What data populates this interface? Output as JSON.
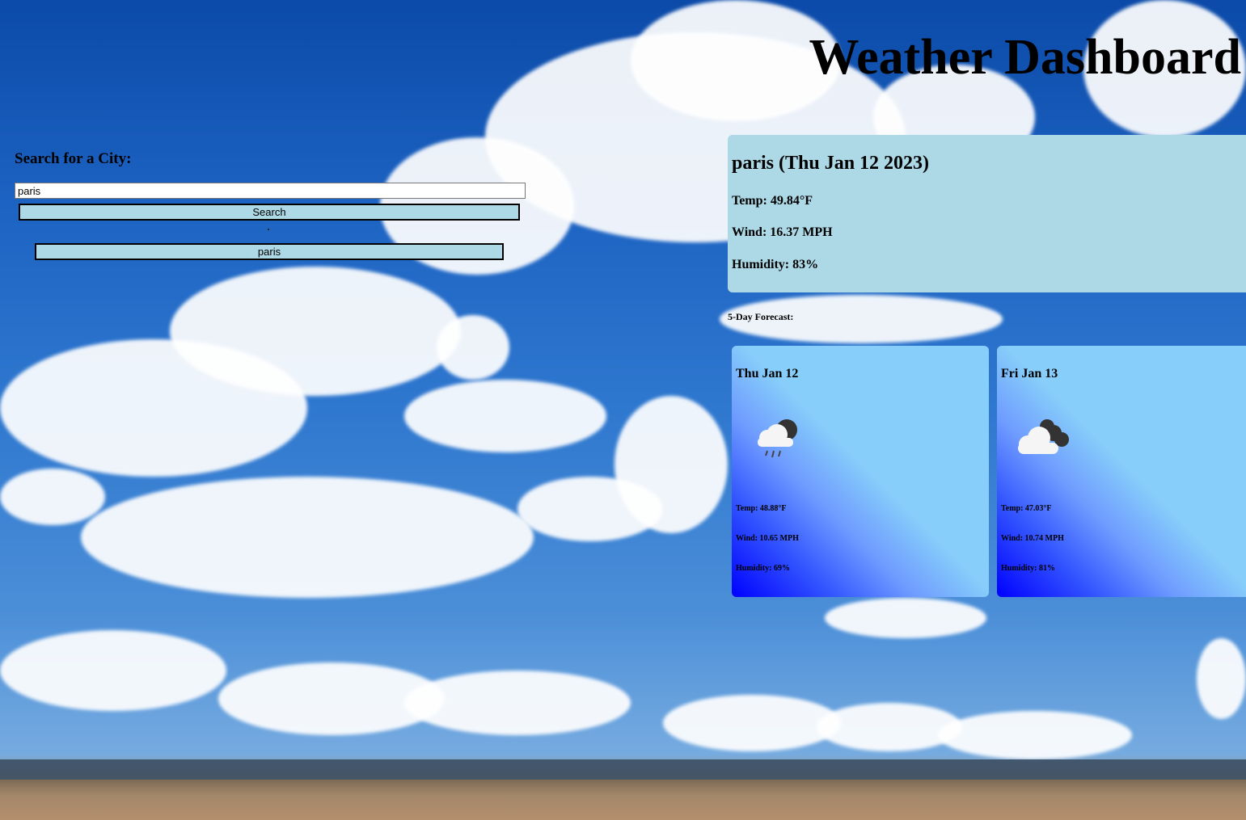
{
  "header": {
    "title": "Weather Dashboard"
  },
  "search": {
    "label": "Search for a City:",
    "input_value": "paris",
    "button_label": "Search",
    "history": [
      "paris"
    ]
  },
  "current": {
    "heading": "paris (Thu Jan 12 2023)",
    "temp": "Temp: 49.84°F",
    "wind": "Wind: 16.37 MPH",
    "humidity": "Humidity: 83%"
  },
  "forecast": {
    "label": "5-Day Forecast:",
    "days": [
      {
        "date": "Thu Jan 12",
        "icon": "rain-cloud-icon",
        "temp": "Temp: 48.88°F",
        "wind": "Wind: 10.65 MPH",
        "humidity": "Humidity: 69%"
      },
      {
        "date": "Fri Jan 13",
        "icon": "cloudy-icon",
        "temp": "Temp: 47.03°F",
        "wind": "Wind: 10.74 MPH",
        "humidity": "Humidity: 81%"
      }
    ]
  },
  "colors": {
    "panel": "#add8e6",
    "card_light": "#87cefa",
    "card_dark": "#0000ff"
  }
}
